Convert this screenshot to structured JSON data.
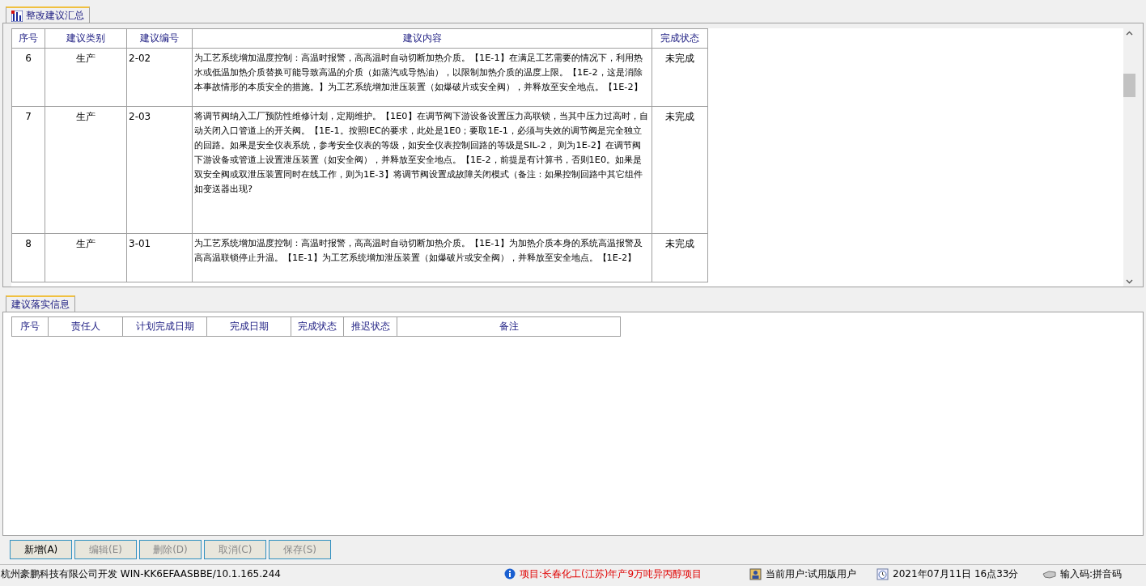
{
  "summary_tab": {
    "label": "整改建议汇总",
    "selected": true
  },
  "summary_table": {
    "columns": [
      "序号",
      "建议类别",
      "建议编号",
      "建议内容",
      "完成状态"
    ],
    "rows": [
      {
        "cells": [
          "6",
          "生产",
          "2-02",
          "为工艺系统增加温度控制：高温时报警，高高温时自动切断加热介质。【1E-1】在满足工艺需要的情况下，利用热水或低温加热介质替换可能导致高温的介质（如蒸汽或导热油），以限制加热介质的温度上限。【1E-2，这是消除本事故情形的本质安全的措施。】为工艺系统增加泄压装置（如爆破片或安全阀），并释放至安全地点。【1E-2】",
          "未完成"
        ]
      },
      {
        "cells": [
          "7",
          "生产",
          "2-03",
          "将调节阀纳入工厂预防性维修计划，定期维护。【1E0】在调节阀下游设备设置压力高联锁，当其中压力过高时，自动关闭入口管道上的开关阀。【1E-1。按照IEC的要求，此处是1E0；要取1E-1，必须与失效的调节阀是完全独立的回路。如果是安全仪表系统，参考安全仪表的等级，如安全仪表控制回路的等级是SIL-2， 则为1E-2】在调节阀下游设备或管道上设置泄压装置（如安全阀），并释放至安全地点。【1E-2，前提是有计算书，否则1E0。如果是双安全阀或双泄压装置同时在线工作，则为1E-3】将调节阀设置成故障关闭模式（备注：如果控制回路中其它组件如变送器出现?",
          "未完成"
        ]
      },
      {
        "cells": [
          "8",
          "生产",
          "3-01",
          "为工艺系统增加温度控制：高温时报警，高高温时自动切断加热介质。【1E-1】为加热介质本身的系统高温报警及高高温联锁停止升温。【1E-1】为工艺系统增加泄压装置（如爆破片或安全阀），并释放至安全地点。【1E-2】",
          "未完成"
        ]
      }
    ]
  },
  "detail_tab": {
    "label": "建议落实信息",
    "selected": true
  },
  "detail_table": {
    "columns": [
      "序号",
      "责任人",
      "计划完成日期",
      "完成日期",
      "完成状态",
      "推迟状态",
      "备注"
    ]
  },
  "buttons": [
    {
      "label": "新增(A)",
      "disabled": false
    },
    {
      "label": "编辑(E)",
      "disabled": true
    },
    {
      "label": "删除(D)",
      "disabled": true
    },
    {
      "label": "取消(C)",
      "disabled": true
    },
    {
      "label": "保存(S)",
      "disabled": true
    }
  ],
  "status_bar": {
    "developer": "杭州豪鹏科技有限公司开发  WIN-KK6EFAASBBE/10.1.165.244",
    "project": "项目:长春化工(江苏)年产9万吨异丙醇项目",
    "user": "当前用户:试用版用户",
    "datetime": "2021年07月11日 16点33分",
    "input_method": "输入码:拼音码"
  }
}
